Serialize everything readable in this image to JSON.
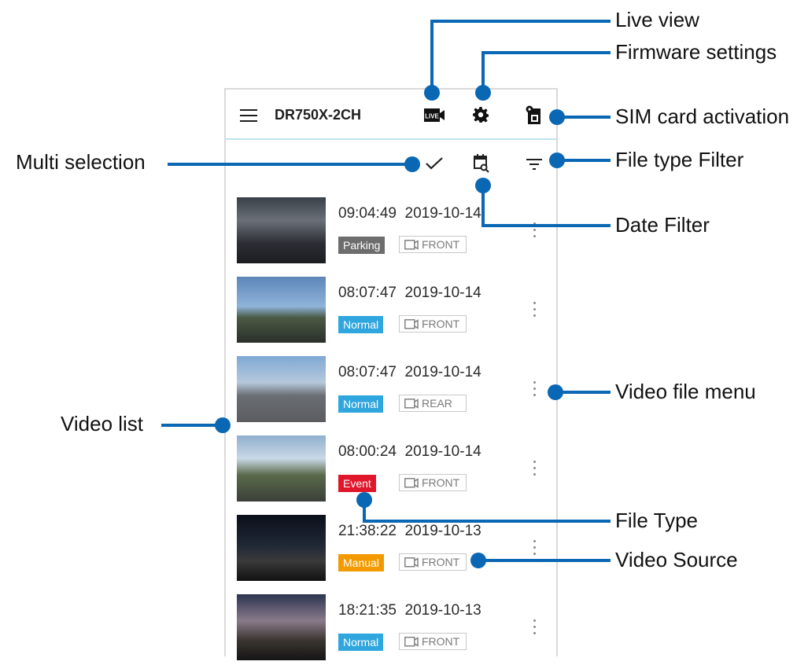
{
  "app": {
    "title": "DR750X-2CH"
  },
  "callouts": {
    "live_view": "Live view",
    "firmware_settings": "Firmware settings",
    "sim_card_activation": "SIM card activation",
    "multi_selection": "Multi selection",
    "file_type_filter": "File type Filter",
    "date_filter": "Date Filter",
    "video_file_menu": "Video file menu",
    "video_list": "Video list",
    "file_type": "File Type",
    "video_source": "Video Source"
  },
  "icons": {
    "menu": "hamburger-icon",
    "live": "live-view-icon",
    "settings": "gear-icon",
    "sim": "sim-card-icon",
    "multi": "check-icon",
    "date": "calendar-search-icon",
    "filter": "filter-icon",
    "more": "more-vertical-icon",
    "source": "video-camera-icon",
    "live_label": "LIVE"
  },
  "colors": {
    "parking": "#6d6d6d",
    "normal": "#2fa6de",
    "event": "#e0162b",
    "manual": "#f29a00",
    "callout": "#0a67b3"
  },
  "videos": [
    {
      "time": "09:04:49  2019-10-14",
      "type": "Parking",
      "source": "FRONT"
    },
    {
      "time": "08:07:47  2019-10-14",
      "type": "Normal",
      "source": "FRONT"
    },
    {
      "time": "08:07:47  2019-10-14",
      "type": "Normal",
      "source": "REAR"
    },
    {
      "time": "08:00:24  2019-10-14",
      "type": "Event",
      "source": "FRONT"
    },
    {
      "time": "21:38:22  2019-10-13",
      "type": "Manual",
      "source": "FRONT"
    },
    {
      "time": "18:21:35  2019-10-13",
      "type": "Normal",
      "source": "FRONT"
    }
  ]
}
